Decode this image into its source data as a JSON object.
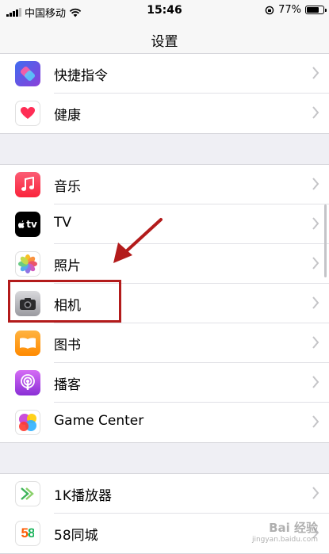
{
  "status_bar": {
    "carrier": "中国移动",
    "time": "15:46",
    "battery": "77%",
    "battery_level": 0.77
  },
  "nav": {
    "title": "设置"
  },
  "groups": [
    {
      "items": [
        {
          "label": "快捷指令",
          "icon": "shortcuts-icon"
        },
        {
          "label": "健康",
          "icon": "health-icon"
        }
      ]
    },
    {
      "items": [
        {
          "label": "音乐",
          "icon": "music-icon"
        },
        {
          "label": "TV",
          "icon": "appletv-icon"
        },
        {
          "label": "照片",
          "icon": "photos-icon"
        },
        {
          "label": "相机",
          "icon": "camera-icon"
        },
        {
          "label": "图书",
          "icon": "books-icon"
        },
        {
          "label": "播客",
          "icon": "podcasts-icon"
        },
        {
          "label": "Game Center",
          "icon": "gamecenter-icon"
        }
      ]
    },
    {
      "items": [
        {
          "label": "1K播放器",
          "icon": "1k-player-icon"
        },
        {
          "label": "58同城",
          "icon": "58-tongcheng-icon"
        }
      ]
    }
  ],
  "icon_labels": {
    "tv": "tv",
    "fifty_eight": "58"
  },
  "watermark": {
    "line1": "Bai 经验",
    "line2": "jingyan.baidu.com"
  },
  "colors": {
    "annotation": "#b31b1b",
    "background": "#efeff4"
  }
}
